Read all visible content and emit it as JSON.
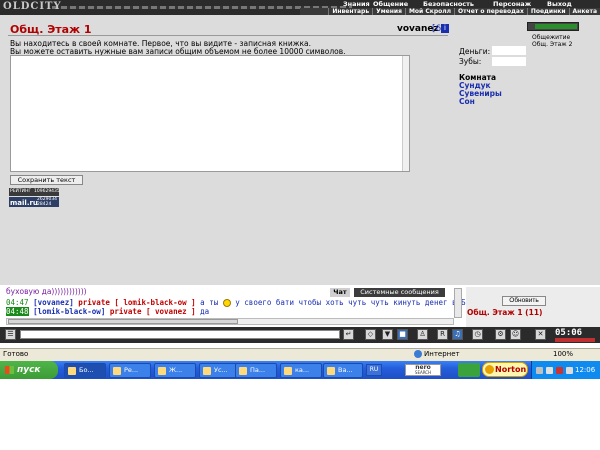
{
  "app": {
    "logo": "OLDCITY"
  },
  "menu": {
    "top": [
      "Знания",
      "Общение",
      "Безопасность",
      "Персонаж",
      "Выход"
    ],
    "bottom": [
      "Инвентарь",
      "Умения",
      "Мой Скролл",
      "Отчет о переводах",
      "Поединки",
      "Анкета"
    ]
  },
  "room": {
    "title": "Общ. Этаж 1",
    "user": "vovanez",
    "level": "[6]",
    "info_icon": "i"
  },
  "notepad": {
    "line1": "Вы находитесь в своей комнате. Первое, что вы видите - записная книжка.",
    "line2": "Вы можете оставить нужные вам записи общим объемом не более 10000 символов.",
    "value": "",
    "save_label": "Сохранить текст"
  },
  "counters": {
    "rating": {
      "label": "РЕЙТИНГ",
      "value1": "109629435"
    },
    "mail": {
      "label": "mail.ru",
      "value1": "2629034",
      "value2": "28424"
    }
  },
  "sidebar": {
    "money_label": "Деньги:",
    "money_value": "",
    "teeth_label": "Зубы:",
    "teeth_value": "",
    "room_heading": "Комната",
    "room_links": [
      "Сундук",
      "Сувениры",
      "Сон"
    ]
  },
  "locations": {
    "items": [
      "Общежитие",
      "Общ. Этаж 2"
    ]
  },
  "chat": {
    "tabs": [
      "Чат",
      "Системные сообщения"
    ],
    "first_line": "буховую да))))))))))))",
    "messages": [
      {
        "time": "04:47",
        "name": "vovanez",
        "target": "private [ lomik-black-ow ]",
        "text": "а ты",
        "text2": "у своего бати чтобы хоть чуть чуть кинуть денег в БК"
      },
      {
        "time": "04:48",
        "name": "lomik-black-ow",
        "target": "private [ vovanez ]",
        "text": "да"
      }
    ],
    "input_value": ""
  },
  "online": {
    "refresh_label": "Обновить",
    "title": "Общ. Этаж 1 (11)"
  },
  "toolbar": {
    "clock": "05:06"
  },
  "browser": {
    "status": "Готово",
    "zone": "Интернет",
    "zoom": "100%"
  },
  "taskbar": {
    "start_label": "пуск",
    "tasks": [
      "Бо...",
      "Ре...",
      "Ж...",
      "Ус...",
      "Па...",
      "ка...",
      "Ва..."
    ],
    "lang": "RU",
    "nero_label": "nero",
    "nero_sub": "SEARCH",
    "norton_label": "Norton",
    "time": "12:06"
  },
  "colors": {
    "title_red": "#b00000",
    "link_blue": "#1a2fb0",
    "frame_grey": "#dcdcdc",
    "taskbar_blue": "#245edb",
    "start_green": "#3c9c36"
  }
}
